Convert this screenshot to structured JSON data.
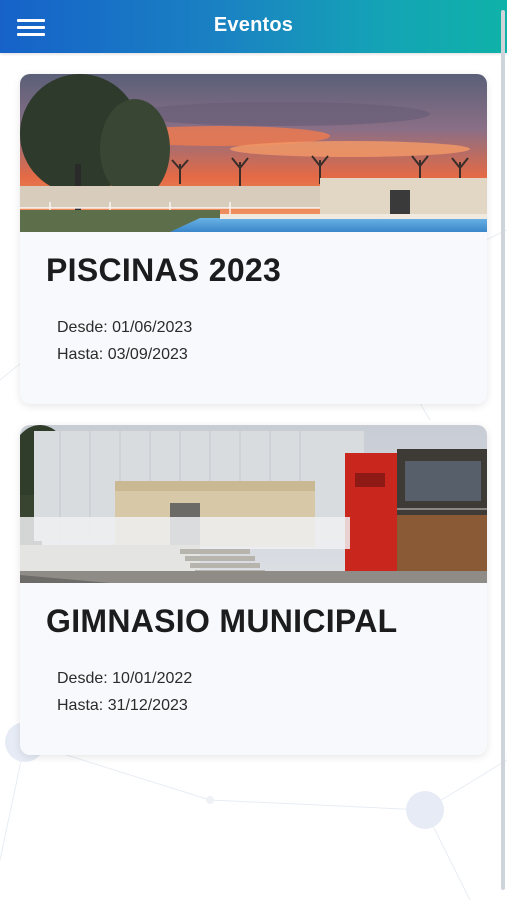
{
  "header": {
    "title": "Eventos",
    "menu_icon": "hamburger-menu-icon"
  },
  "events": [
    {
      "title": "PISCINAS 2023",
      "desde": "Desde: 01/06/2023",
      "hasta": "Hasta: 03/09/2023",
      "image": "swimming-pool-sunset-photo"
    },
    {
      "title": "GIMNASIO MUNICIPAL",
      "desde": "Desde: 10/01/2022",
      "hasta": "Hasta: 31/12/2023",
      "image": "municipal-gym-building-photo"
    }
  ],
  "colors": {
    "header_gradient_start": "#1662c9",
    "header_gradient_end": "#0fb2a8",
    "card_background": "#f7f9fc",
    "title_text": "#1c1c1e"
  }
}
